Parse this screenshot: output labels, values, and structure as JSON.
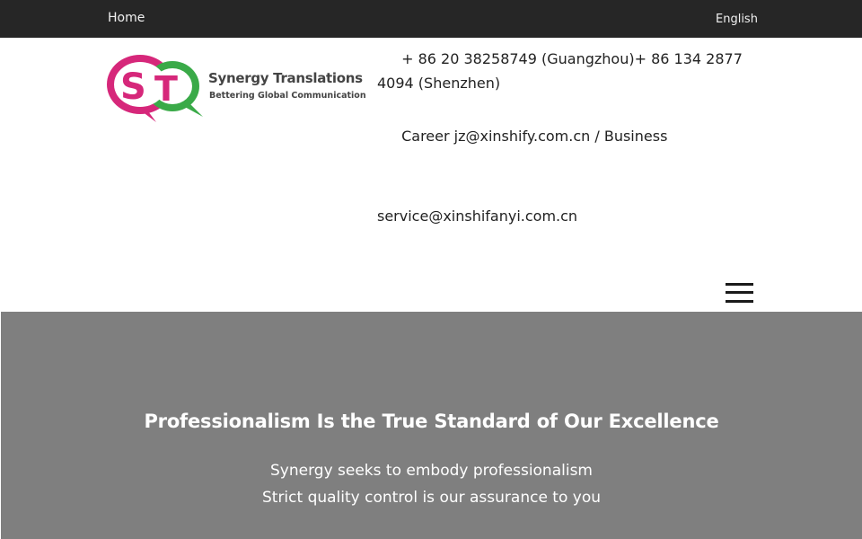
{
  "topbar": {
    "home_label": "Home",
    "lang_glyph": "",
    "lang_label": "English",
    "bg_color": "#262626"
  },
  "logo": {
    "icon": "speech-bubbles-st-logo",
    "brand_name": "Synergy Translations",
    "tagline": "Bettering Global Communication",
    "colors": {
      "magenta": "#d6277a",
      "green": "#3aaa48"
    }
  },
  "contact": {
    "phone_icon": "",
    "phone_text": "+ 86 20 38258749 (Guangzhou)+ 86 134 2877 4094 (Shenzhen)",
    "email_icon": "",
    "email_text": "Career jz@xinshify.com.cn / Business",
    "service_text": "service@xinshifanyi.com.cn"
  },
  "menu": {
    "icon": "hamburger-menu-icon"
  },
  "hero": {
    "title": "Professionalism Is the True Standard of Our Excellence",
    "line1": "Synergy seeks to embody professionalism",
    "line2": "Strict quality control is our assurance to you",
    "bg_color": "#7f7f7f"
  }
}
